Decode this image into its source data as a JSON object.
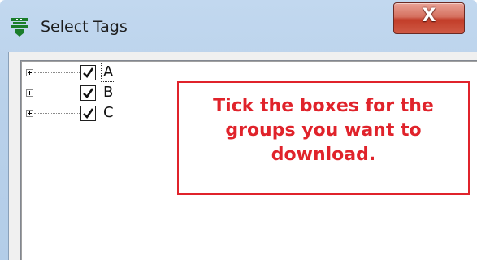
{
  "window": {
    "title": "Select Tags",
    "close_glyph": "X"
  },
  "tree": {
    "nodes": [
      {
        "label": "A",
        "checked": true,
        "focused": true
      },
      {
        "label": "B",
        "checked": true,
        "focused": false
      },
      {
        "label": "C",
        "checked": true,
        "focused": false
      }
    ]
  },
  "callout": {
    "lines": [
      "Tick the boxes for the",
      "groups you want to",
      "download."
    ],
    "color": "#e0232b"
  },
  "icons": {
    "app": "tag-app-icon",
    "expand": "plus-expander-icon",
    "check": "checkmark-icon"
  }
}
